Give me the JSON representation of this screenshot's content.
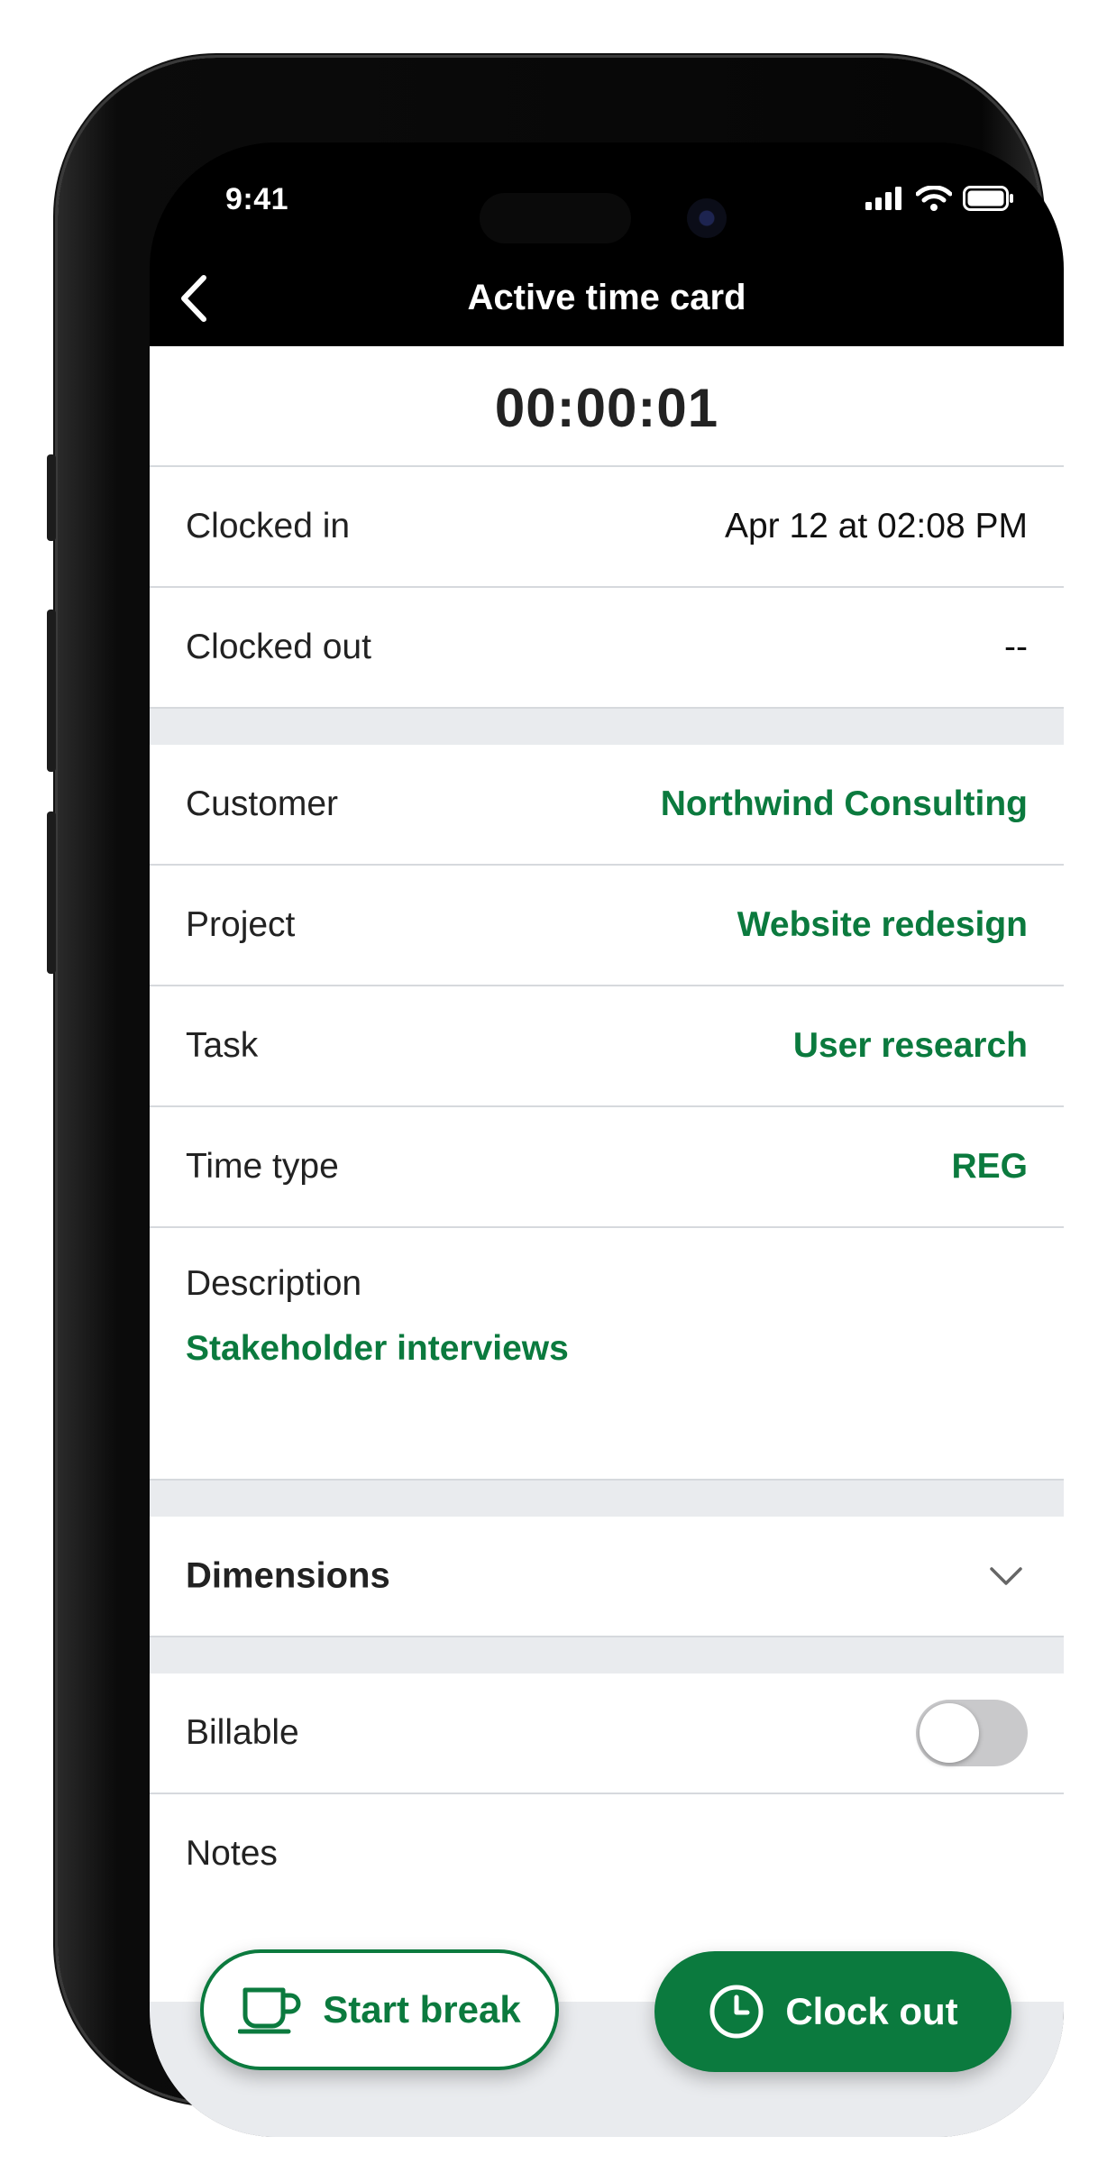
{
  "status_bar": {
    "time": "9:41"
  },
  "nav": {
    "title": "Active time card"
  },
  "timer": {
    "elapsed": "00:00:01"
  },
  "clock": {
    "in_label": "Clocked in",
    "in_value": "Apr 12 at 02:08 PM",
    "out_label": "Clocked out",
    "out_value": "--"
  },
  "details": [
    {
      "label": "Customer",
      "value": "Northwind Consulting"
    },
    {
      "label": "Project",
      "value": "Website redesign"
    },
    {
      "label": "Task",
      "value": "User research"
    },
    {
      "label": "Time type",
      "value": "REG"
    }
  ],
  "description": {
    "label": "Description",
    "value": "Stakeholder interviews"
  },
  "dimensions": {
    "label": "Dimensions"
  },
  "billable": {
    "label": "Billable",
    "on": false
  },
  "notes": {
    "label": "Notes"
  },
  "actions": {
    "start_break": "Start break",
    "clock_out": "Clock out"
  },
  "colors": {
    "accent": "#0b7a3e",
    "background": "#e9ebee"
  }
}
